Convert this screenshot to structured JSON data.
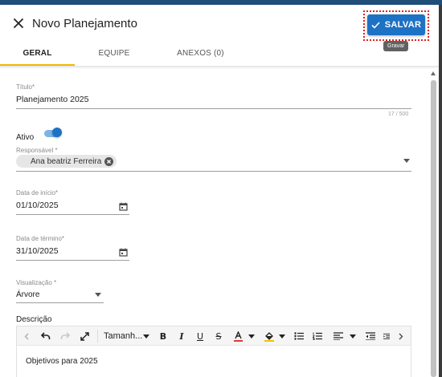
{
  "header": {
    "title": "Novo Planejamento",
    "save_label": "SALVAR",
    "save_tooltip": "Gravar",
    "close_icon": "close-icon",
    "save_icon": "check-icon"
  },
  "tabs": [
    {
      "label": "GERAL",
      "active": true
    },
    {
      "label": "EQUIPE",
      "active": false
    },
    {
      "label": "ANEXOS (0)",
      "active": false
    }
  ],
  "form": {
    "titulo": {
      "label": "Título*",
      "value": "Planejamento 2025",
      "counter": "17 / 500"
    },
    "ativo": {
      "label": "Ativo",
      "checked": true
    },
    "responsavel": {
      "label": "Responsável *",
      "chip": "Ana beatriz Ferreira"
    },
    "data_inicio": {
      "label": "Data de início*",
      "value": "01/10/2025"
    },
    "data_termino": {
      "label": "Data de término*",
      "value": "31/10/2025"
    },
    "visualizacao": {
      "label": "Visualização *",
      "value": "Árvore"
    },
    "descricao": {
      "label": "Descrição",
      "toolbar_font_size": "Tamanh...",
      "content": "Objetivos para 2025"
    }
  },
  "colors": {
    "primary": "#1e72c4",
    "tab_indicator": "#f2b705",
    "focus_outline": "#e02020",
    "top_strip": "#1f4e79",
    "font_color_underline": "#e53935",
    "highlight_underline": "#f2c200"
  }
}
